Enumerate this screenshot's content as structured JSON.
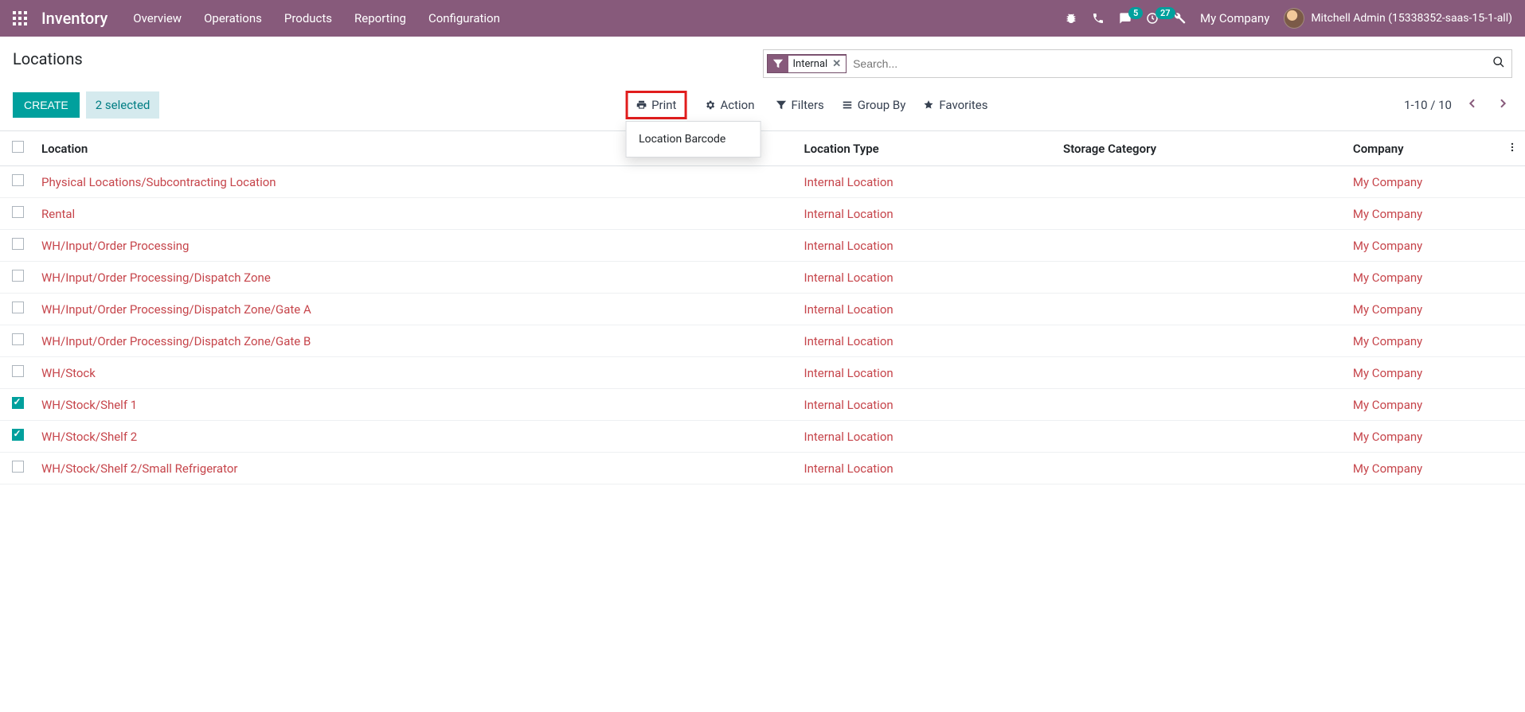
{
  "navbar": {
    "brand": "Inventory",
    "menu": [
      "Overview",
      "Operations",
      "Products",
      "Reporting",
      "Configuration"
    ],
    "msg_badge": "5",
    "activity_badge": "27",
    "company": "My Company",
    "user": "Mitchell Admin (15338352-saas-15-1-all)"
  },
  "breadcrumb": "Locations",
  "search": {
    "facet_label": "Internal",
    "placeholder": "Search..."
  },
  "buttons": {
    "create": "Create",
    "selection": "2 selected",
    "print": "Print",
    "action": "Action"
  },
  "print_menu": {
    "item1": "Location Barcode"
  },
  "search_opts": {
    "filters": "Filters",
    "groupby": "Group By",
    "favorites": "Favorites"
  },
  "pager": {
    "range": "1-10 / 10"
  },
  "columns": {
    "location": "Location",
    "type": "Location Type",
    "storage": "Storage Category",
    "company": "Company"
  },
  "rows": [
    {
      "checked": false,
      "location": "Physical Locations/Subcontracting Location",
      "type": "Internal Location",
      "storage": "",
      "company": "My Company"
    },
    {
      "checked": false,
      "location": "Rental",
      "type": "Internal Location",
      "storage": "",
      "company": "My Company"
    },
    {
      "checked": false,
      "location": "WH/Input/Order Processing",
      "type": "Internal Location",
      "storage": "",
      "company": "My Company"
    },
    {
      "checked": false,
      "location": "WH/Input/Order Processing/Dispatch Zone",
      "type": "Internal Location",
      "storage": "",
      "company": "My Company"
    },
    {
      "checked": false,
      "location": "WH/Input/Order Processing/Dispatch Zone/Gate A",
      "type": "Internal Location",
      "storage": "",
      "company": "My Company"
    },
    {
      "checked": false,
      "location": "WH/Input/Order Processing/Dispatch Zone/Gate B",
      "type": "Internal Location",
      "storage": "",
      "company": "My Company"
    },
    {
      "checked": false,
      "location": "WH/Stock",
      "type": "Internal Location",
      "storage": "",
      "company": "My Company"
    },
    {
      "checked": true,
      "location": "WH/Stock/Shelf 1",
      "type": "Internal Location",
      "storage": "",
      "company": "My Company"
    },
    {
      "checked": true,
      "location": "WH/Stock/Shelf 2",
      "type": "Internal Location",
      "storage": "",
      "company": "My Company"
    },
    {
      "checked": false,
      "location": "WH/Stock/Shelf 2/Small Refrigerator",
      "type": "Internal Location",
      "storage": "",
      "company": "My Company"
    }
  ]
}
